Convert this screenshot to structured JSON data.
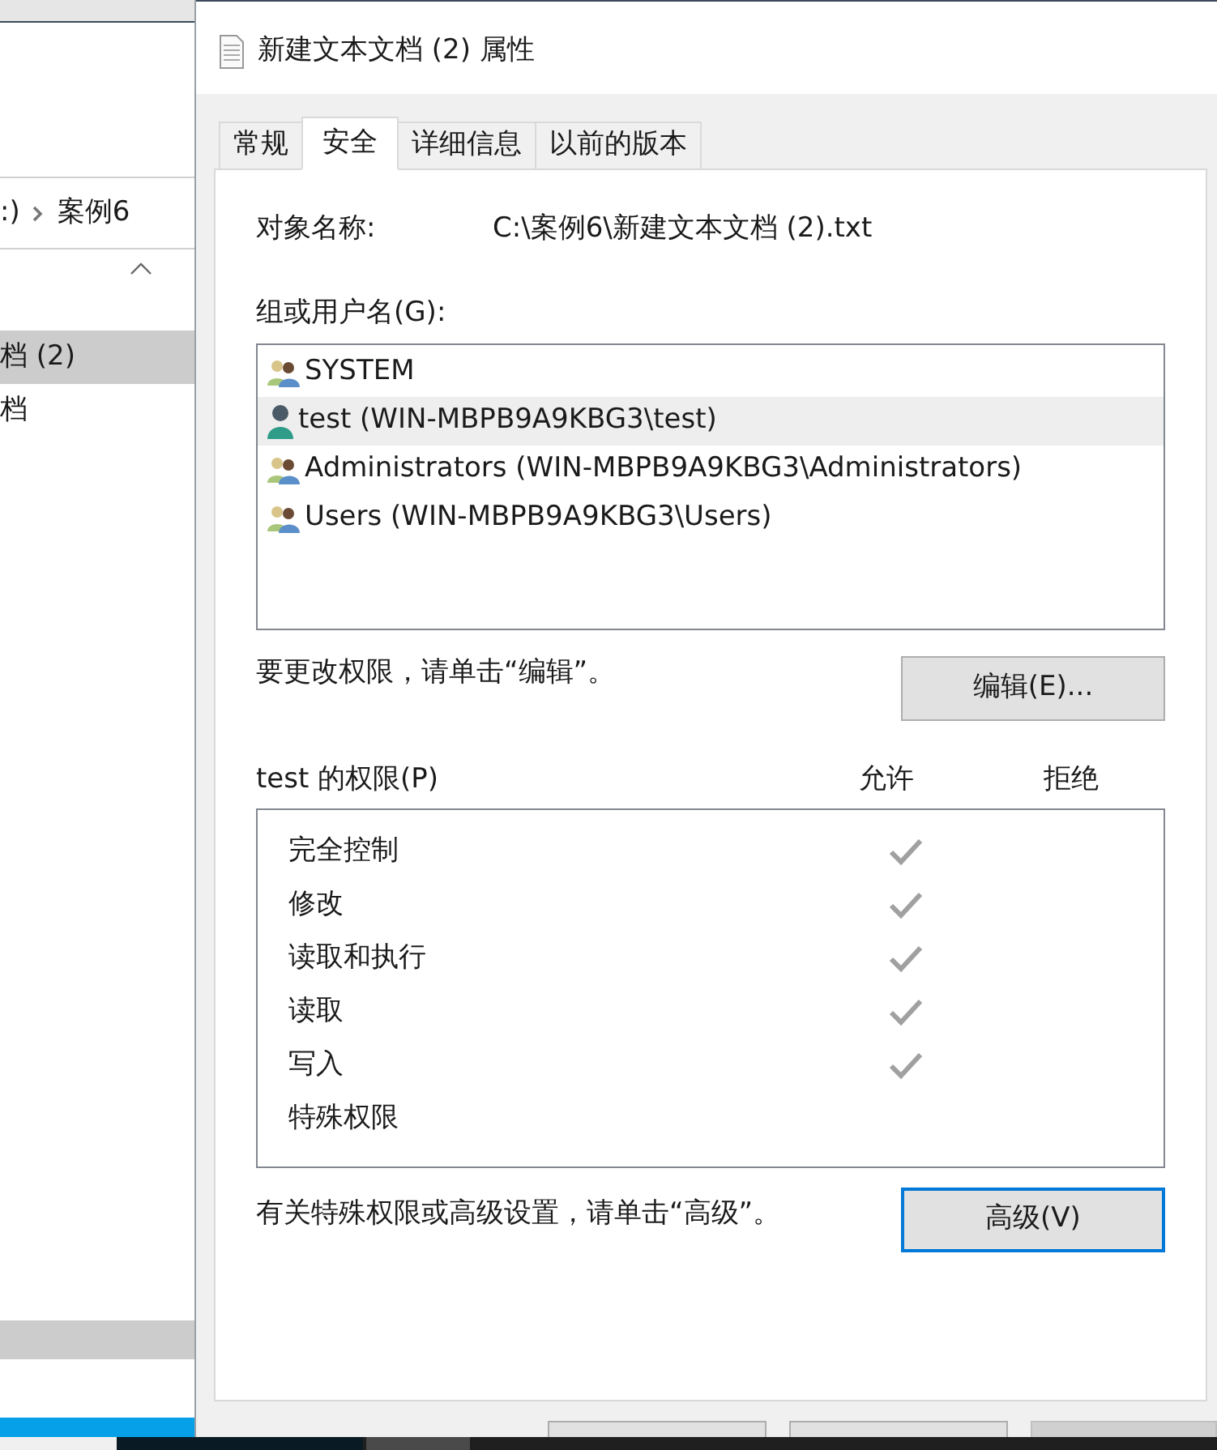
{
  "explorer": {
    "breadcrumb": [
      ":)",
      "案例6"
    ],
    "files": [
      {
        "name": "档 (2)",
        "selected": true
      },
      {
        "name": "档",
        "selected": false
      }
    ]
  },
  "dialog": {
    "title": "新建文本文档 (2) 属性",
    "tabs": [
      {
        "label": "常规",
        "selected": false
      },
      {
        "label": "安全",
        "selected": true
      },
      {
        "label": "详细信息",
        "selected": false
      },
      {
        "label": "以前的版本",
        "selected": false
      }
    ],
    "object_label": "对象名称:",
    "object_name": "C:\\案例6\\新建文本文档 (2).txt",
    "groups_label": "组或用户名(G):",
    "users": [
      {
        "name": "SYSTEM",
        "kind": "group",
        "selected": false
      },
      {
        "name": "test (WIN-MBPB9A9KBG3\\test)",
        "kind": "user",
        "selected": true
      },
      {
        "name": "Administrators (WIN-MBPB9A9KBG3\\Administrators)",
        "kind": "group",
        "selected": false
      },
      {
        "name": "Users (WIN-MBPB9A9KBG3\\Users)",
        "kind": "group",
        "selected": false
      }
    ],
    "edit_hint": "要更改权限，请单击“编辑”。",
    "edit_button": "编辑(E)...",
    "permissions_label": "test 的权限(P)",
    "allow_header": "允许",
    "deny_header": "拒绝",
    "permissions": [
      {
        "name": "完全控制",
        "allow": true
      },
      {
        "name": "修改",
        "allow": true
      },
      {
        "name": "读取和执行",
        "allow": true
      },
      {
        "name": "读取",
        "allow": true
      },
      {
        "name": "写入",
        "allow": true
      },
      {
        "name": "特殊权限",
        "allow": false
      }
    ],
    "advanced_hint": "有关特殊权限或高级设置，请单击“高级”。",
    "advanced_button": "高级(V)"
  }
}
